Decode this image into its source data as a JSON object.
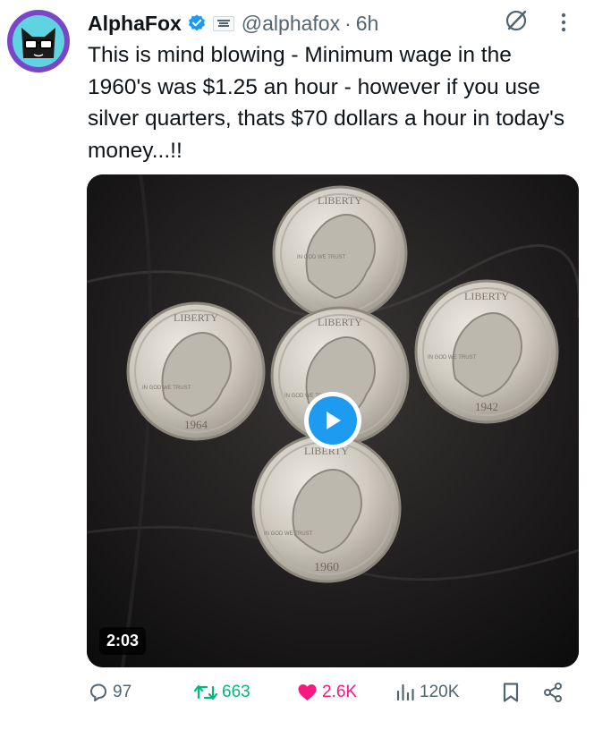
{
  "post": {
    "author_name": "AlphaFox",
    "handle": "@alphafox",
    "separator": "·",
    "time": "6h",
    "text": "This is mind blowing - Minimum wage in the 1960's was $1.25 an hour - however if you use silver quarters, thats $70 dollars a hour in today's money...!!"
  },
  "media": {
    "type": "video",
    "duration": "2:03",
    "coins": [
      {
        "top_text": "LIBERTY",
        "bottom_text": "",
        "side_text": "IN GOD WE TRUST"
      },
      {
        "top_text": "LIBERTY",
        "bottom_text": "1964",
        "side_text": "IN GOD WE TRUST"
      },
      {
        "top_text": "LIBERTY",
        "bottom_text": "",
        "side_text": "IN GOD WE TRUST"
      },
      {
        "top_text": "LIBERTY",
        "bottom_text": "1942",
        "side_text": "IN GOD WE TRUST"
      },
      {
        "top_text": "LIBERTY",
        "bottom_text": "1960",
        "side_text": "IN GOD WE TRUST"
      }
    ]
  },
  "actions": {
    "replies": "97",
    "reposts": "663",
    "likes": "2.6K",
    "views": "120K"
  },
  "colors": {
    "accent": "#1d9bf0",
    "repost": "#00ba7c",
    "like": "#f91880",
    "muted": "#536471"
  },
  "icons": [
    "verified-badge-icon",
    "affiliate-badge-icon",
    "grok-icon",
    "more-icon",
    "play-icon",
    "reply-icon",
    "repost-icon",
    "heart-icon",
    "views-icon",
    "bookmark-icon",
    "share-icon"
  ]
}
